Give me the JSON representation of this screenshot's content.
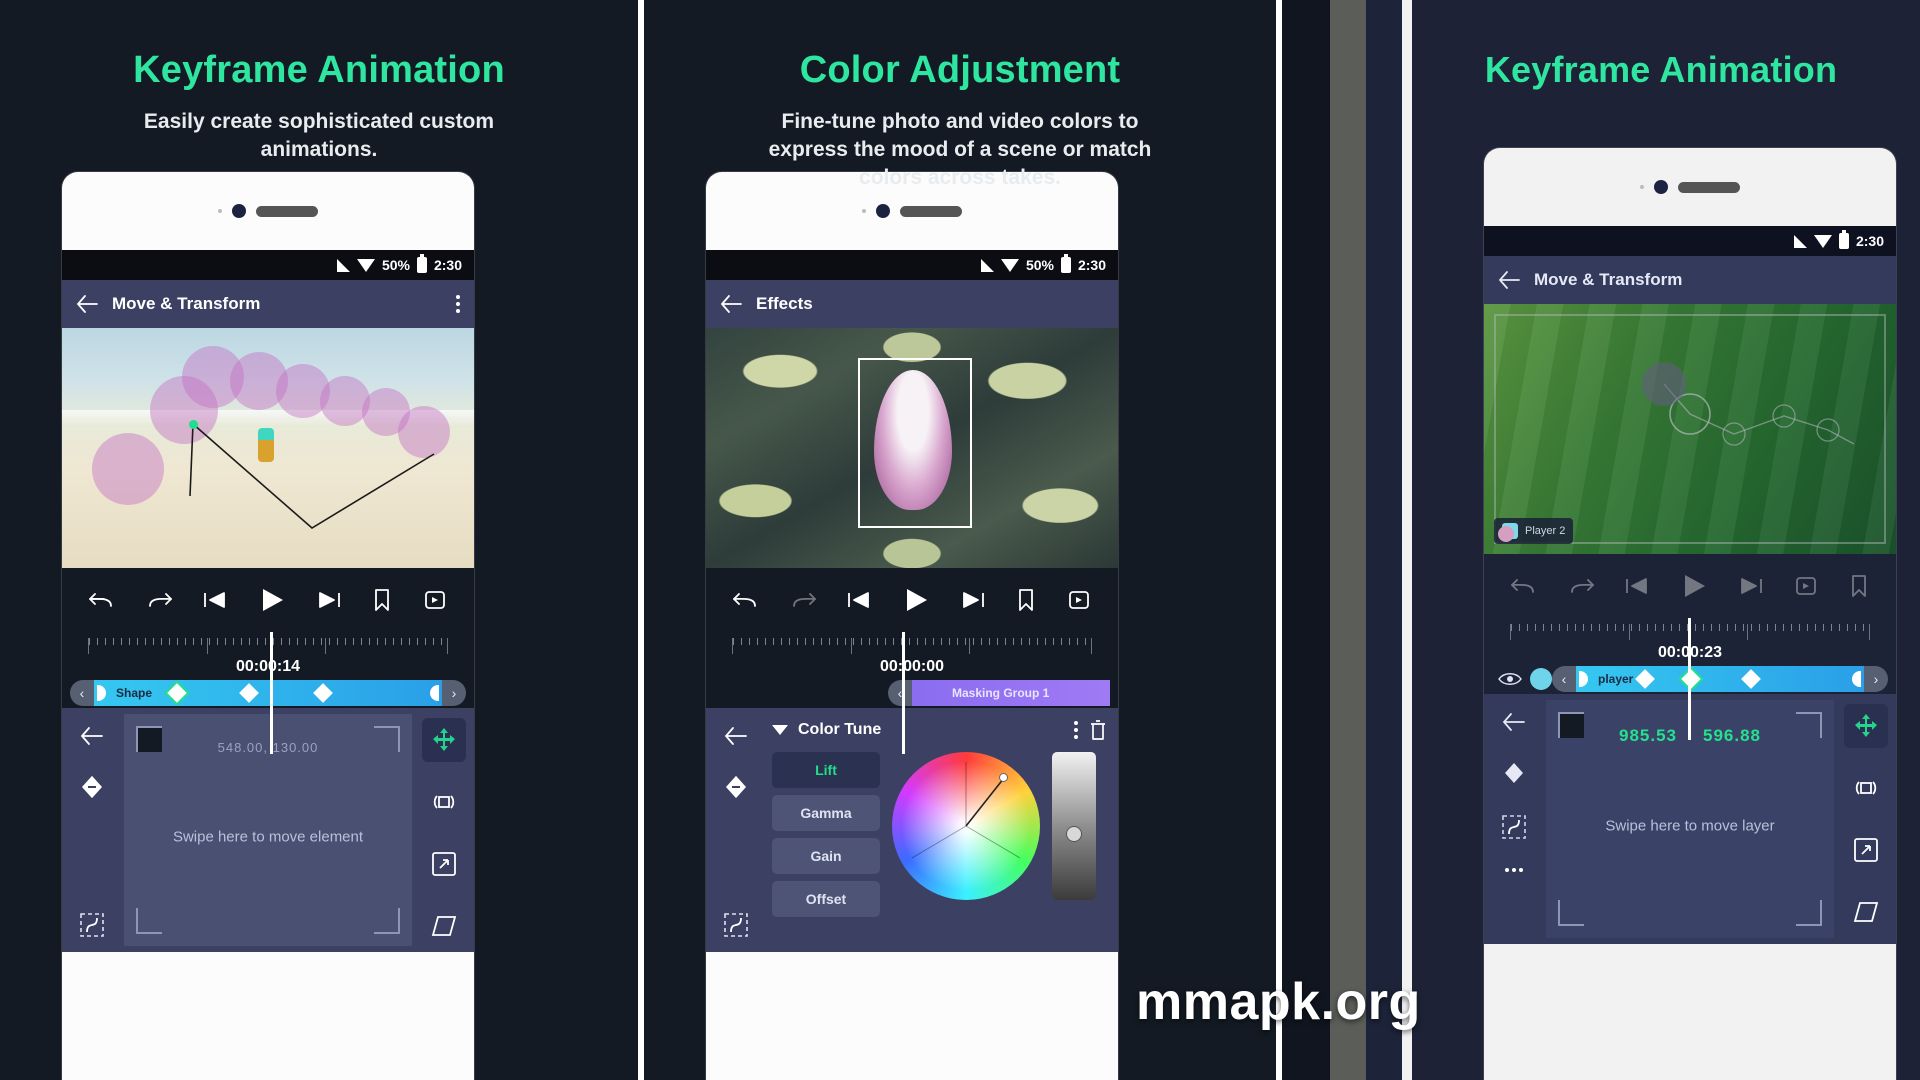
{
  "panels": [
    {
      "heading": "Keyframe Animation",
      "subheading": "Easily create sophisticated custom animations.",
      "status": {
        "battery": "50%",
        "time": "2:30"
      },
      "appbar_title": "Move & Transform",
      "timecode": "00:00:14",
      "clip_label": "Shape",
      "coord_text": "548.00, 130.00",
      "swipe_hint": "Swipe here to move element",
      "transport": [
        "undo-icon",
        "redo-icon",
        "skip-start-icon",
        "play-icon",
        "skip-end-icon",
        "bookmark-icon",
        "loop-icon"
      ]
    },
    {
      "heading": "Color Adjustment",
      "subheading": "Fine-tune photo and video colors to express the mood of a scene or match colors across takes.",
      "status": {
        "battery": "50%",
        "time": "2:30"
      },
      "appbar_title": "Effects",
      "timecode": "00:00:00",
      "clip_label": "Masking Group 1",
      "panel_title": "Color Tune",
      "tabs": [
        {
          "label": "Lift",
          "active": true
        },
        {
          "label": "Gamma",
          "active": false
        },
        {
          "label": "Gain",
          "active": false
        },
        {
          "label": "Offset",
          "active": false
        }
      ],
      "transport": [
        "undo-icon",
        "redo-icon",
        "skip-start-icon",
        "play-icon",
        "skip-end-icon",
        "bookmark-icon",
        "loop-icon"
      ]
    },
    {
      "heading": "Keyframe Animation",
      "status": {
        "battery": "",
        "time": "2:30"
      },
      "appbar_title": "Move & Transform",
      "timecode": "00:00:23",
      "clip_label": "player",
      "layer_chip": "Player 2",
      "coord_x": "985.53",
      "coord_y": "596.88",
      "swipe_hint": "Swipe here to move layer",
      "transport": [
        "undo-icon",
        "redo-icon",
        "skip-start-icon",
        "play-icon",
        "skip-end-icon",
        "loop-icon",
        "bookmark-icon"
      ]
    }
  ],
  "watermark": "mmapk.org",
  "colors": {
    "heading": "#2fe6a0",
    "accent_green": "#23dd8c",
    "clip_blue": "#35c8f0",
    "clip_purple": "#8a6df0",
    "appbar": "#3c4163",
    "background": "#141a24"
  }
}
